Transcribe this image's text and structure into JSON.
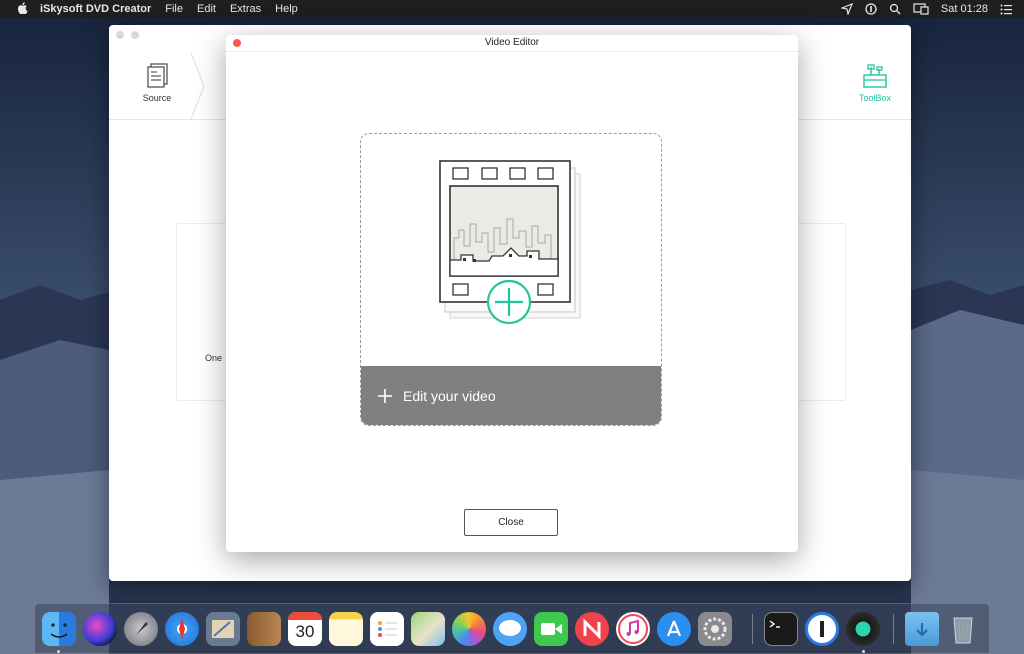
{
  "menubar": {
    "app_name": "iSkysoft DVD Creator",
    "menus": [
      "File",
      "Edit",
      "Extras",
      "Help"
    ],
    "clock": "Sat 01:28"
  },
  "app_window": {
    "steps": [
      {
        "label": "Source",
        "icon": "document-icon"
      },
      {
        "label": "ToolBox",
        "icon": "toolbox-icon"
      }
    ],
    "partial_text": "One",
    "accent_color": "#1fc59e"
  },
  "modal": {
    "title": "Video Editor",
    "drop_zone_label": "Edit your video",
    "close_label": "Close"
  },
  "dock": {
    "apps": [
      {
        "name": "Finder",
        "icon": "finder-icon"
      },
      {
        "name": "Siri",
        "icon": "siri-icon"
      },
      {
        "name": "Launchpad",
        "icon": "launchpad-icon"
      },
      {
        "name": "Safari",
        "icon": "safari-icon"
      },
      {
        "name": "Mail",
        "icon": "mail-icon"
      },
      {
        "name": "Contacts",
        "icon": "contacts-icon"
      },
      {
        "name": "Calendar",
        "icon": "calendar-icon",
        "badge": "30"
      },
      {
        "name": "Notes",
        "icon": "notes-icon"
      },
      {
        "name": "Reminders",
        "icon": "reminders-icon"
      },
      {
        "name": "Maps",
        "icon": "maps-icon"
      },
      {
        "name": "Photos",
        "icon": "photos-icon"
      },
      {
        "name": "Messages",
        "icon": "messages-icon"
      },
      {
        "name": "FaceTime",
        "icon": "facetime-icon"
      },
      {
        "name": "News",
        "icon": "news-icon"
      },
      {
        "name": "iTunes",
        "icon": "itunes-icon"
      },
      {
        "name": "App Store",
        "icon": "app-store-icon"
      },
      {
        "name": "System Preferences",
        "icon": "system-preferences-icon"
      },
      {
        "name": "Terminal",
        "icon": "terminal-icon"
      },
      {
        "name": "1Password",
        "icon": "onepassword-icon"
      },
      {
        "name": "iSkysoft DVD Creator",
        "icon": "dvd-creator-icon"
      },
      {
        "name": "Downloads",
        "icon": "downloads-folder-icon"
      },
      {
        "name": "Trash",
        "icon": "trash-icon"
      }
    ]
  }
}
